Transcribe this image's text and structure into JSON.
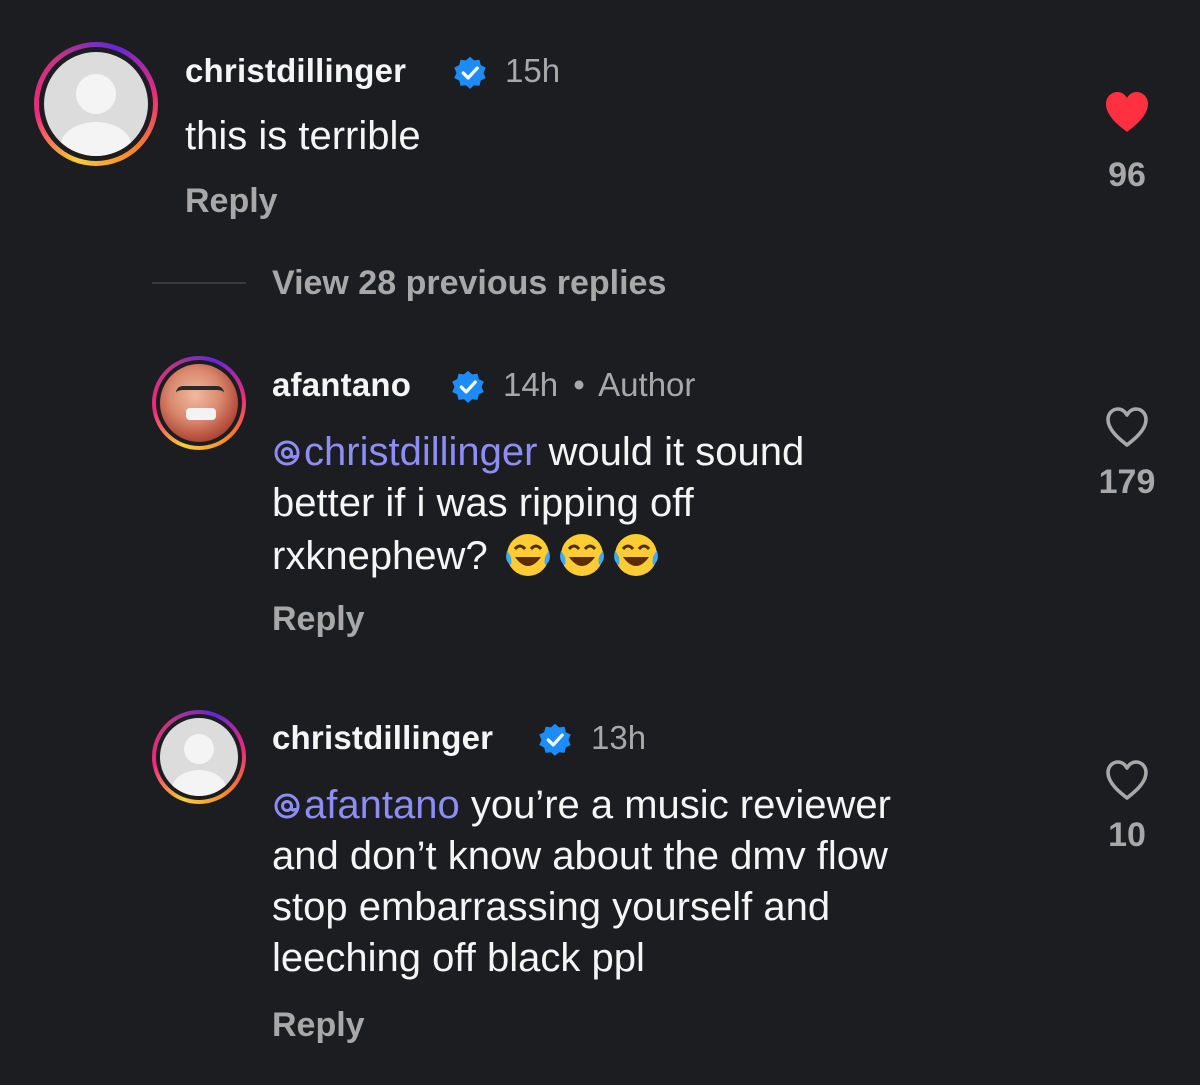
{
  "colors": {
    "background": "#1c1d21",
    "mention": "#8e8cf5",
    "verified": "#1d8cf8",
    "like_active": "#ff3040",
    "muted": "#a8a8a8"
  },
  "comments": [
    {
      "username": "christdillinger",
      "time": "15h",
      "author_tag": "",
      "mention": "",
      "text": "this is terrible",
      "reply": "Reply",
      "likes": "96",
      "liked": true
    },
    {
      "username": "afantano",
      "time": "14h",
      "separator": "•",
      "author_tag": "Author",
      "mention": "christdillinger",
      "text_line1": " would it sound",
      "text_line2": "better if i was ripping off",
      "text_line3": "rxknephew?",
      "emoji": "face-with-tears-of-joy x3",
      "reply": "Reply",
      "likes": "179",
      "liked": false
    },
    {
      "username": "christdillinger",
      "time": "13h",
      "mention": "afantano",
      "text_line1": " you’re a music reviewer",
      "text_line2": "and don’t know about the dmv flow",
      "text_line3": "stop embarrassing yourself and",
      "text_line4": "leeching off black ppl",
      "reply": "Reply",
      "likes": "10",
      "liked": false
    }
  ],
  "view_replies": "View 28 previous replies"
}
